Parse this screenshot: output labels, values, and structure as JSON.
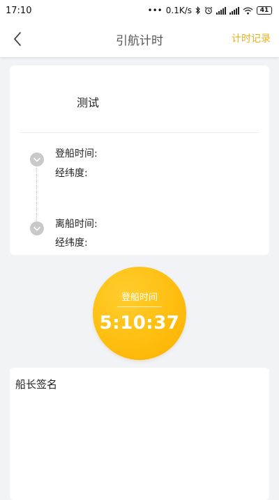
{
  "status_bar": {
    "time": "17:10",
    "network_speed": "0.1K/s",
    "battery": "41",
    "icons": [
      "bluetooth-icon",
      "alarm-icon",
      "signal-icon",
      "signal-icon",
      "wifi-icon",
      "battery-icon"
    ]
  },
  "header": {
    "title": "引航计时",
    "records_link": "计时记录",
    "back_icon": "chevron-left-icon"
  },
  "info": {
    "name": "测试",
    "boarding_time_label": "登船时间:",
    "boarding_time_value": "",
    "boarding_coords_label": "经纬度:",
    "boarding_coords_value": "",
    "leaving_time_label": "离船时间:",
    "leaving_time_value": "",
    "leaving_coords_label": "经纬度:",
    "leaving_coords_value": "",
    "timeline_icon": "chevron-down-icon"
  },
  "timer": {
    "label": "登船时间",
    "value": "5:10:37"
  },
  "signature": {
    "label": "船长签名"
  },
  "colors": {
    "accent": "#e6b21e",
    "timer_gradient_start": "#ffcd2e",
    "timer_gradient_end": "#fbb000",
    "background": "#f1f3f7",
    "timeline_icon": "#c9c9c9"
  }
}
